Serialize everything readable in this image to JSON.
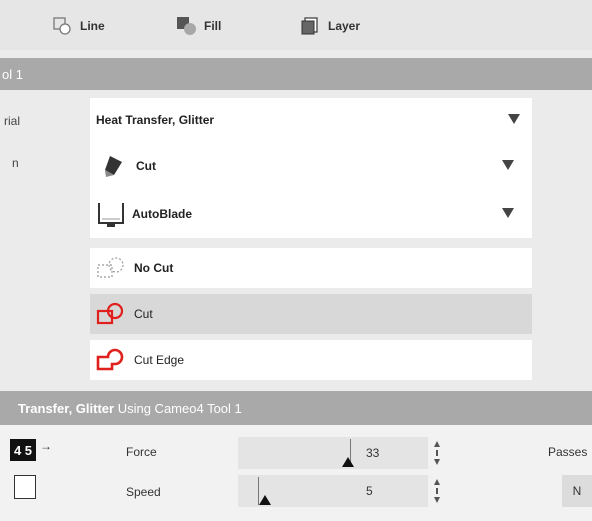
{
  "tabs": {
    "line": "Line",
    "fill": "Fill",
    "layer": "Layer"
  },
  "tool_header": "ol 1",
  "side_labels": {
    "material": "rial",
    "action": "n"
  },
  "selectors": {
    "material": "Heat Transfer, Glitter",
    "action": "Cut",
    "blade": "AutoBlade"
  },
  "actions": {
    "no_cut": "No Cut",
    "cut": "Cut",
    "cut_edge": "Cut Edge",
    "selected": "Cut"
  },
  "status": {
    "material_bold": "Transfer, Glitter",
    "suffix": " Using Cameo4 Tool 1"
  },
  "controls": {
    "blade_depth_partial": "4 5",
    "force_label": "Force",
    "force_value": "33",
    "speed_label": "Speed",
    "speed_value": "5",
    "passes_label": "Passes",
    "passes_button_partial": "N",
    "force_level": 33,
    "force_max": 33,
    "speed_level": 5,
    "speed_max": 30
  },
  "colors": {
    "header_bar": "#a9a9a9",
    "cut_icon_red": "#e0201c",
    "selected_row": "#d8d8d8"
  }
}
